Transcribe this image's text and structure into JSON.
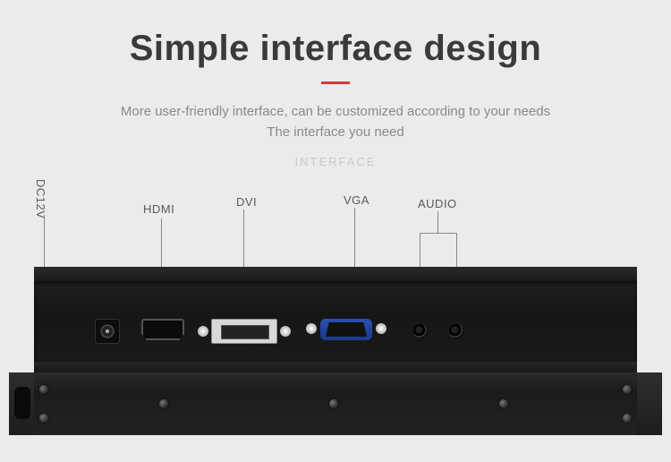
{
  "header": {
    "title": "Simple interface design",
    "subtitle_line1": "More user-friendly interface, can be customized according to your needs",
    "subtitle_line2": "The interface you need",
    "eyebrow": "INTERFACE"
  },
  "ports": {
    "dc": {
      "label": "DC12V"
    },
    "hdmi": {
      "label": "HDMI"
    },
    "dvi": {
      "label": "DVI"
    },
    "vga": {
      "label": "VGA"
    },
    "audio": {
      "label": "AUDIO"
    }
  }
}
